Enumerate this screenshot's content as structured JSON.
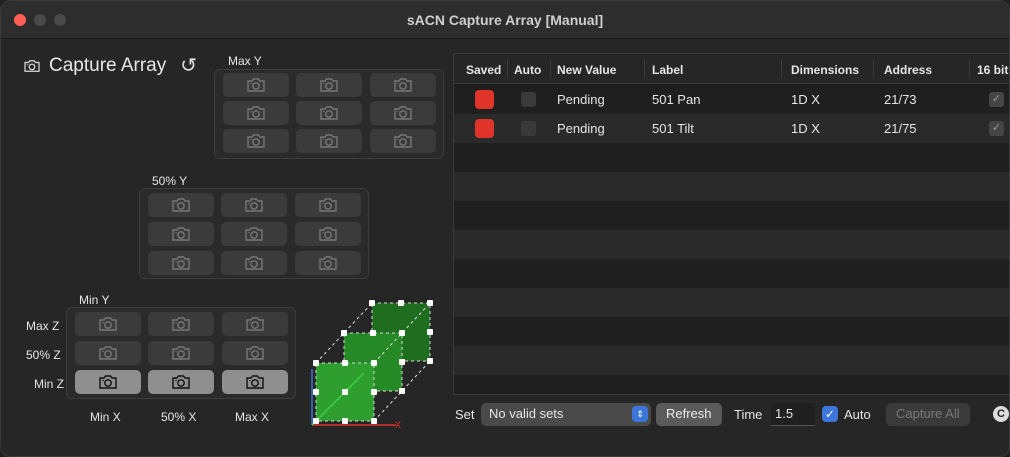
{
  "window": {
    "title": "sACN Capture Array [Manual]"
  },
  "header": {
    "title": "Capture Array",
    "camera_icon": "camera-icon",
    "reset_icon": "reset-icon"
  },
  "groups": {
    "max_y": "Max Y",
    "mid_y": "50% Y",
    "min_y": "Min Y"
  },
  "rows": {
    "max_z": "Max Z",
    "mid_z": "50% Z",
    "min_z": "Min Z"
  },
  "cols": {
    "min_x": "Min X",
    "mid_x": "50% X",
    "max_x": "Max X"
  },
  "table": {
    "headers": {
      "saved": "Saved",
      "auto": "Auto",
      "new_value": "New Value",
      "label": "Label",
      "dimensions": "Dimensions",
      "address": "Address",
      "bit16": "16 bit"
    },
    "rows": [
      {
        "new_value": "Pending",
        "label": "501 Pan",
        "dimensions": "1D X",
        "address": "21/73"
      },
      {
        "new_value": "Pending",
        "label": "501 Tilt",
        "dimensions": "1D X",
        "address": "21/75"
      }
    ]
  },
  "bottom": {
    "set_label": "Set",
    "set_value": "No valid sets",
    "refresh": "Refresh",
    "time_label": "Time",
    "time_value": "1.5",
    "auto_label": "Auto",
    "capture_all": "Capture All",
    "c_icon": "C"
  },
  "colors": {
    "saved": "#e0342a",
    "accent": "#3d76db",
    "cube": "#2e9e2e"
  }
}
